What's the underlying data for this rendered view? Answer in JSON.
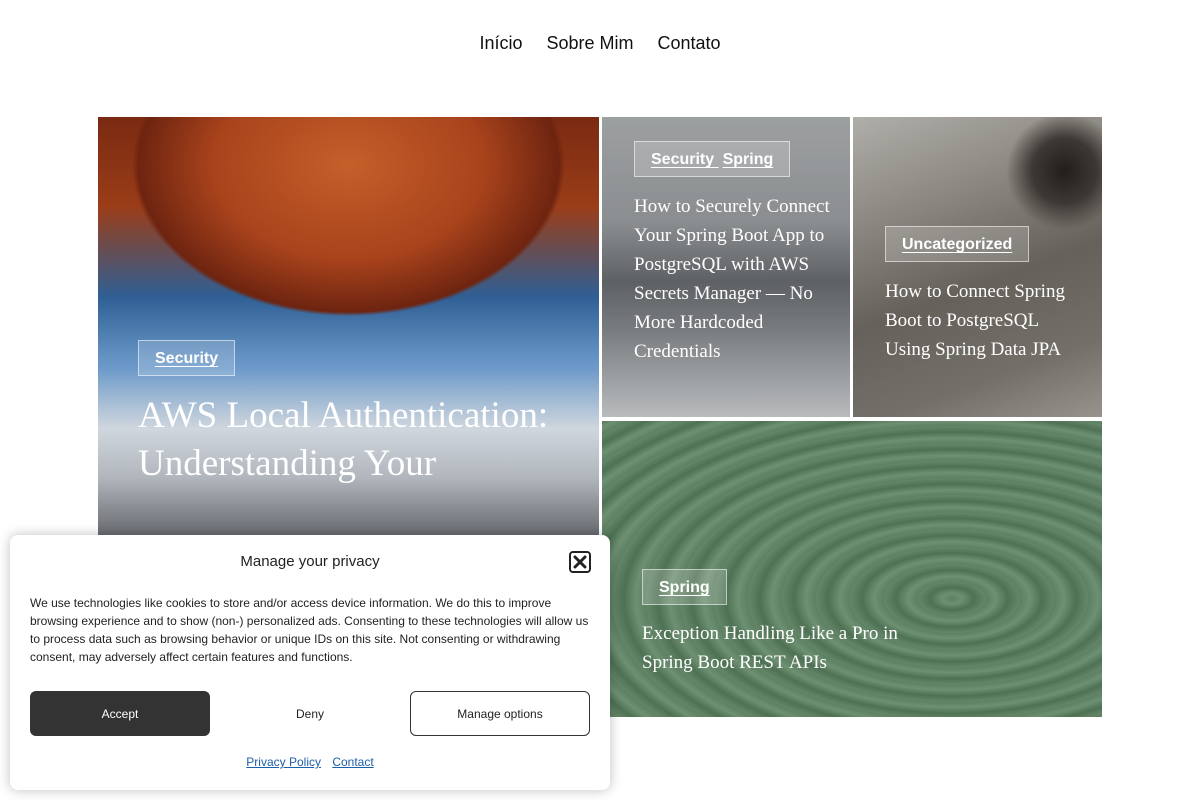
{
  "nav": {
    "items": [
      "Início",
      "Sobre Mim",
      "Contato"
    ]
  },
  "cards": [
    {
      "categories": [
        "Security"
      ],
      "title": "AWS Local Authentication: Understanding Your"
    },
    {
      "categories": [
        "Security",
        "Spring"
      ],
      "title": "How to Securely Connect Your Spring Boot App to PostgreSQL with AWS Secrets Manager — No More Hardcoded Credentials"
    },
    {
      "categories": [
        "Uncategorized"
      ],
      "title": "How to Connect Spring Boot to PostgreSQL Using Spring Data JPA"
    },
    {
      "categories": [
        "Spring"
      ],
      "title": "Exception Handling Like a Pro in Spring Boot REST APIs"
    }
  ],
  "privacy": {
    "heading": "Manage your privacy",
    "close_icon": "close-icon",
    "body": "We use technologies like cookies to store and/or access device information. We do this to improve browsing experience and to show (non-) personalized ads. Consenting to these technologies will allow us to process data such as browsing behavior or unique IDs on this site. Not consenting or withdrawing consent, may adversely affect certain features and functions.",
    "accept": "Accept",
    "deny": "Deny",
    "manage": "Manage options",
    "links": [
      "Privacy Policy",
      "Contact"
    ]
  }
}
